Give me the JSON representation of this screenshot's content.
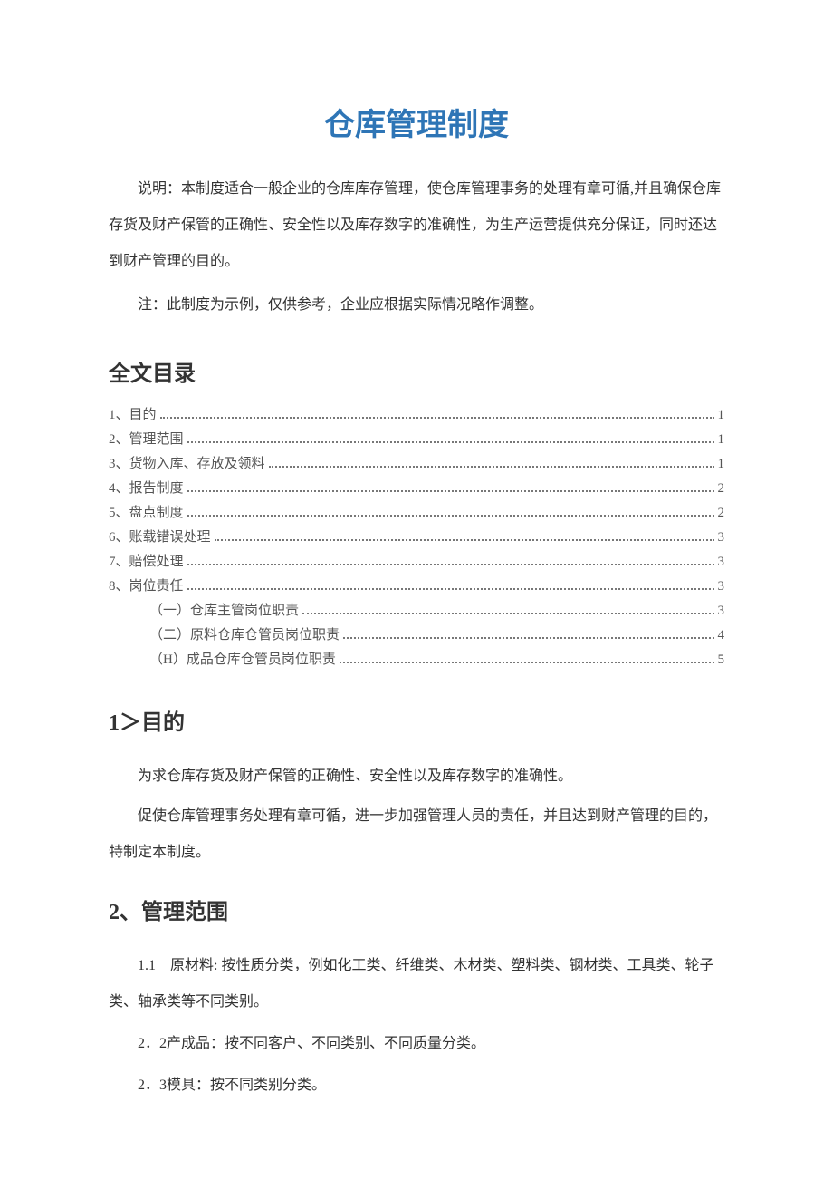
{
  "title": "仓库管理制度",
  "intro": "说明：本制度适合一般企业的仓库库存管理，使仓库管理事务的处理有章可循,并且确保仓库存货及财产保管的正确性、安全性以及库存数字的准确性，为生产运营提供充分保证，同时还达到财产管理的目的。",
  "note": "注：此制度为示例，仅供参考，企业应根据实际情况略作调整。",
  "toc_header": "全文目录",
  "toc": [
    {
      "label": "1、目的",
      "page": "1",
      "sub": false
    },
    {
      "label": "2、管理范围",
      "page": "1",
      "sub": false
    },
    {
      "label": "3、货物入库、存放及领料",
      "page": "1",
      "sub": false
    },
    {
      "label": "4、报告制度",
      "page": "2",
      "sub": false
    },
    {
      "label": "5、盘点制度",
      "page": "2",
      "sub": false
    },
    {
      "label": "6、账载错误处理",
      "page": "3",
      "sub": false
    },
    {
      "label": "7、赔偿处理",
      "page": "3",
      "sub": false
    },
    {
      "label": "8、岗位责任",
      "page": "3",
      "sub": false
    },
    {
      "label": "（一）仓库主管岗位职责",
      "page": "3",
      "sub": true
    },
    {
      "label": "（二）原料仓库仓管员岗位职责",
      "page": "4",
      "sub": true
    },
    {
      "label": "（H）成品仓库仓管员岗位职责",
      "page": "5",
      "sub": true
    }
  ],
  "section1": {
    "heading": "1＞目的",
    "p1": "为求仓库存货及财产保管的正确性、安全性以及库存数字的准确性。",
    "p2": "促使仓库管理事务处理有章可循，进一步加强管理人员的责任，并且达到财产管理的目的，特制定本制度。"
  },
  "section2": {
    "heading": "2、管理范围",
    "p1": "1.1　原材料: 按性质分类，例如化工类、纤维类、木材类、塑料类、钢材类、工具类、轮子类、轴承类等不同类别。",
    "p2": "2．2产成品：按不同客户、不同类别、不同质量分类。",
    "p3": "2．3模具：按不同类别分类。"
  }
}
